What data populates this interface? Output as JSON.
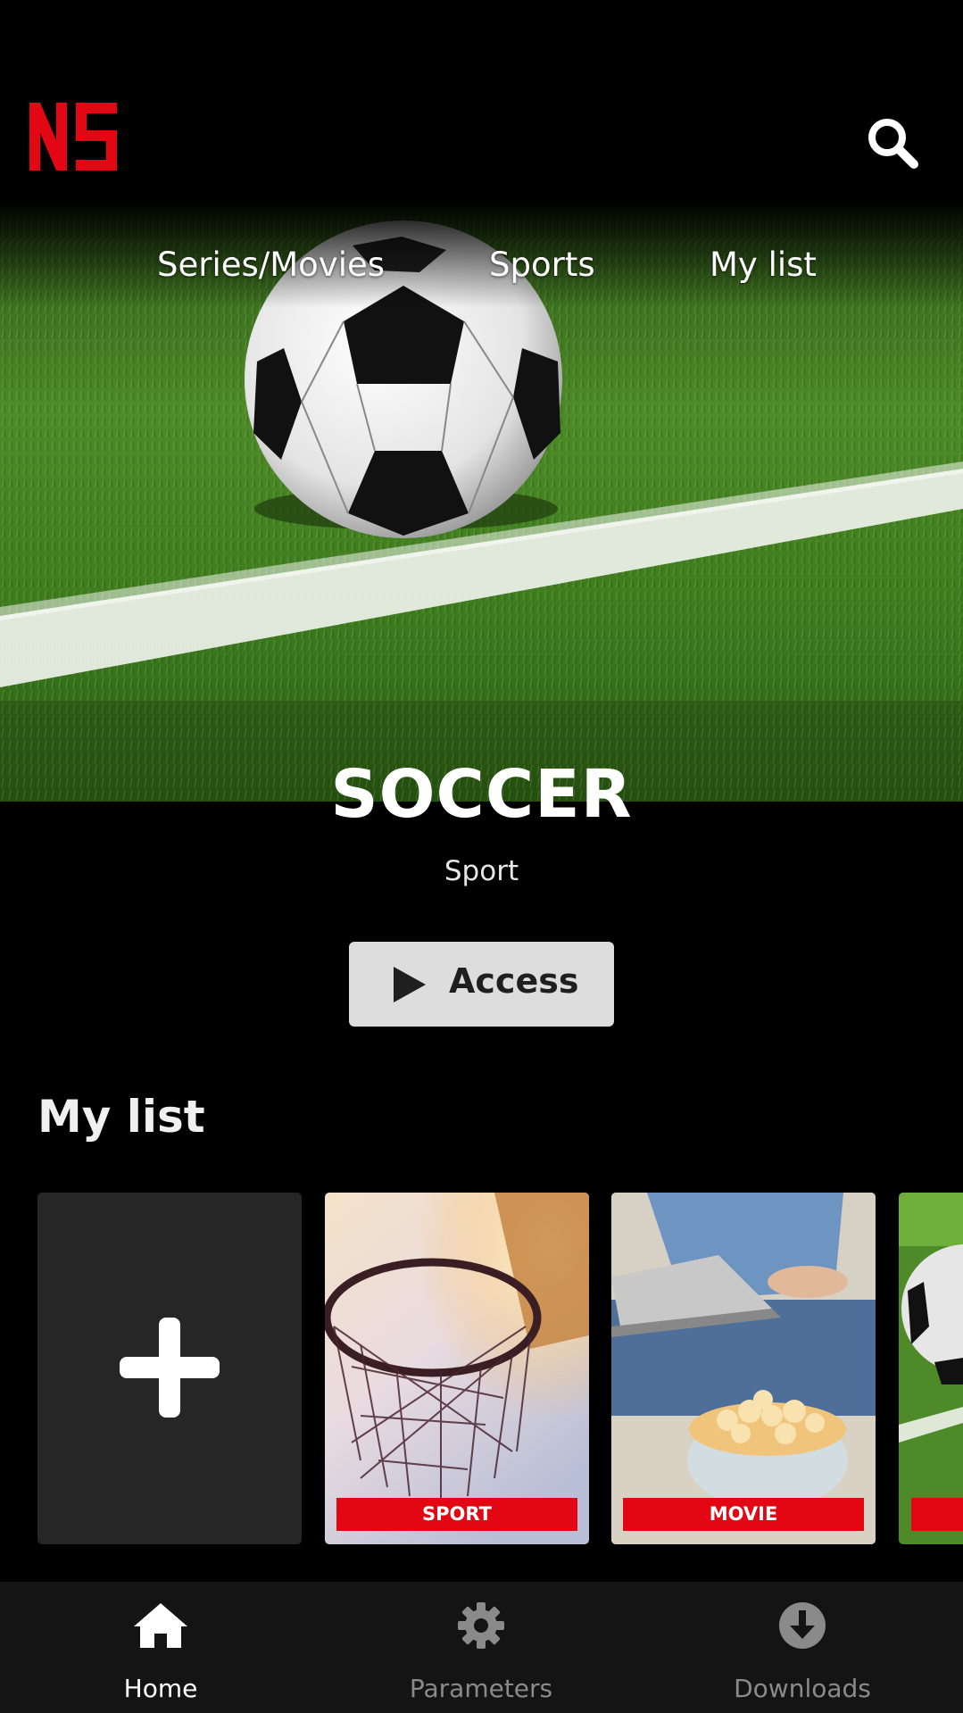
{
  "brand": {
    "logo_text": "NS",
    "accent_color": "#e30613"
  },
  "header": {
    "search_icon": "search-icon"
  },
  "nav": {
    "items": [
      "Series/Movies",
      "Sports",
      "My list"
    ]
  },
  "hero": {
    "title": "SOCCER",
    "genre": "Sport",
    "access_label": "Access",
    "play_icon": "play-icon"
  },
  "my_list": {
    "title": "My list",
    "add_icon": "plus-icon",
    "cards": [
      {
        "badge": "SPORT",
        "image": "basketball-hoop"
      },
      {
        "badge": "MOVIE",
        "image": "popcorn-laptop"
      },
      {
        "badge": "",
        "image": "soccer-ball"
      }
    ]
  },
  "tabbar": {
    "tabs": [
      {
        "label": "Home",
        "icon": "home-icon",
        "active": true
      },
      {
        "label": "Parameters",
        "icon": "gear-icon",
        "active": false
      },
      {
        "label": "Downloads",
        "icon": "download-icon",
        "active": false
      }
    ]
  }
}
